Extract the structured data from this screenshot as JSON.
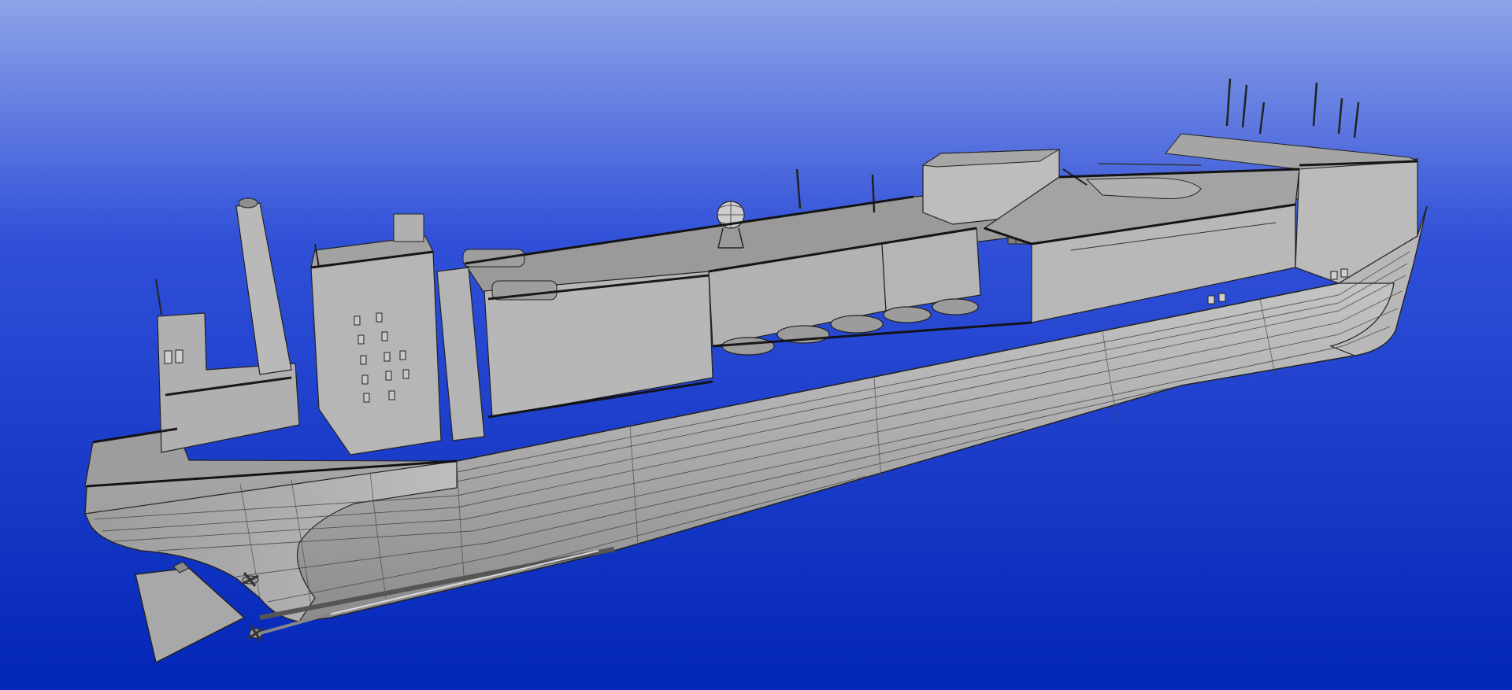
{
  "scene": {
    "subject": "ship-hull-3d-model",
    "render_style": "shaded-wireframe",
    "colors": {
      "background_top": "#8ea3e8",
      "background_mid": "#3050d8",
      "background_bottom": "#0226b8",
      "hull_light": "#c4c4c4",
      "hull_mid": "#a9a9a9",
      "hull_dark": "#8a8a8a",
      "deck": "#9a9a9a",
      "superstructure": "#b2b2b2",
      "edge_lines": "#1a1a1a",
      "railing": "#111111"
    },
    "components": {
      "lifeboat_count": 5,
      "has_helicopter": true,
      "has_radar_dome": true,
      "has_funnel": true,
      "has_rudder": true,
      "has_propeller": true
    }
  }
}
